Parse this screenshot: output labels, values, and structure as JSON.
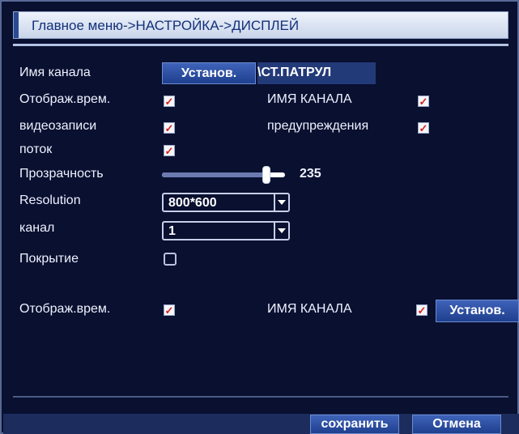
{
  "window": {
    "title": "Главное меню->НАСТРОЙКА->ДИСПЛЕЙ"
  },
  "channel_name": {
    "label": "Имя канала",
    "set_button": "Установ.",
    "value": "\\СТ.ПАТРУЛ"
  },
  "time_display": {
    "label": "Отображ.врем.",
    "checked": true
  },
  "channel_name_display": {
    "label": "ИМЯ КАНАЛА",
    "checked": true
  },
  "record_status": {
    "label": "видеозаписи",
    "checked": true
  },
  "alarm_status": {
    "label": "предупреждения",
    "checked": true
  },
  "stream": {
    "label": "поток",
    "checked": true
  },
  "transparency": {
    "label": "Прозрачность",
    "value": "235",
    "fraction": 0.85
  },
  "resolution": {
    "label": "Resolution",
    "value": "800*600"
  },
  "channel": {
    "label": "канал",
    "value": "1"
  },
  "cover": {
    "label": "Покрытие",
    "checked": false
  },
  "tour_settings": {
    "time_label": "Отображ.врем.",
    "time_checked": true,
    "name_label": "ИМЯ КАНАЛА",
    "name_checked": true,
    "set_button": "Установ."
  },
  "footer": {
    "save_button": "сохранить",
    "cancel_button": "Отмена"
  },
  "colors": {
    "background": "#091030",
    "button": "#2a4b9e",
    "check_mark": "#d9211c"
  }
}
